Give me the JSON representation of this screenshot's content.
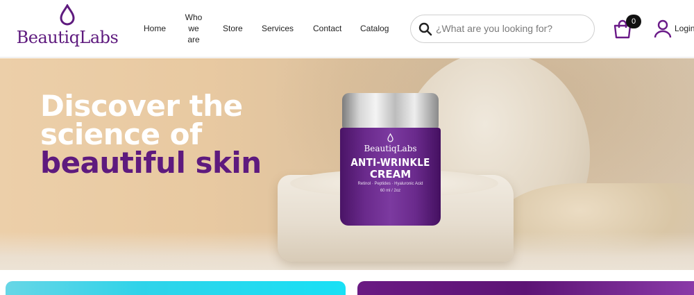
{
  "brand": {
    "name": "BeautiqLabs",
    "accent": "#5e1a7e"
  },
  "nav": {
    "home": "Home",
    "who_we_are": [
      "Who",
      "we",
      "are"
    ],
    "store": "Store",
    "services": "Services",
    "contact": "Contact",
    "catalog": "Catalog"
  },
  "search": {
    "placeholder": "¿What are you looking for?",
    "value": ""
  },
  "cart": {
    "count": "0",
    "icon": "shopping-bag-icon"
  },
  "user": {
    "login_label": "Login",
    "icon": "user-icon"
  },
  "hero": {
    "line1": "Discover the",
    "line2": "science of",
    "line3": "beautiful skin",
    "product": {
      "brand": "BeautiqLabs",
      "title_line1": "ANTI-WRINKLE",
      "title_line2": "CREAM",
      "ingredients": "Retinol · Peptides · Hyaluronic Acid",
      "volume": "60 ml / 2oz"
    }
  },
  "colors": {
    "teal_card": "#2fd3e9",
    "purple_card": "#5d1475"
  }
}
